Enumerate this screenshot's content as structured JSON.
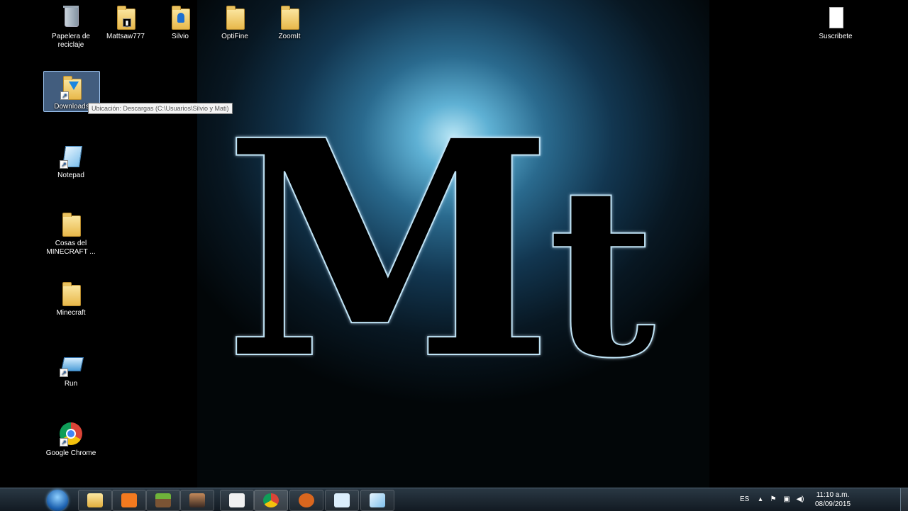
{
  "desktop": {
    "logo_text": "Mt",
    "icons": {
      "recycle": "Papelera de reciclaje",
      "mattsaw": "Mattsaw777",
      "silvio": "Silvio",
      "optifine": "OptiFine",
      "zoomit": "ZoomIt",
      "suscribete": "Suscribete",
      "downloads": "Downloads",
      "notepad": "Notepad",
      "cosas": "Cosas del MINECRAFT ...",
      "minecraft": "Minecraft",
      "run": "Run",
      "chrome": "Google Chrome"
    },
    "tooltip": "Ubicación: Descargas (C:\\Usuarios\\Silvio y Mati)"
  },
  "taskbar": {
    "language": "ES",
    "time": "11:10 a.m.",
    "date": "08/09/2015",
    "pinned": [
      "explorer-icon",
      "media-player-icon",
      "minecraft-icon",
      "game-character-icon",
      "agar-io-icon",
      "chrome-icon",
      "glove-icon",
      "magnifier-icon",
      "notepad-icon"
    ]
  },
  "colors": {
    "wallpaper_glow": "#5fb1d4",
    "taskbar": "#1c2730",
    "selection": "#78aae6"
  }
}
